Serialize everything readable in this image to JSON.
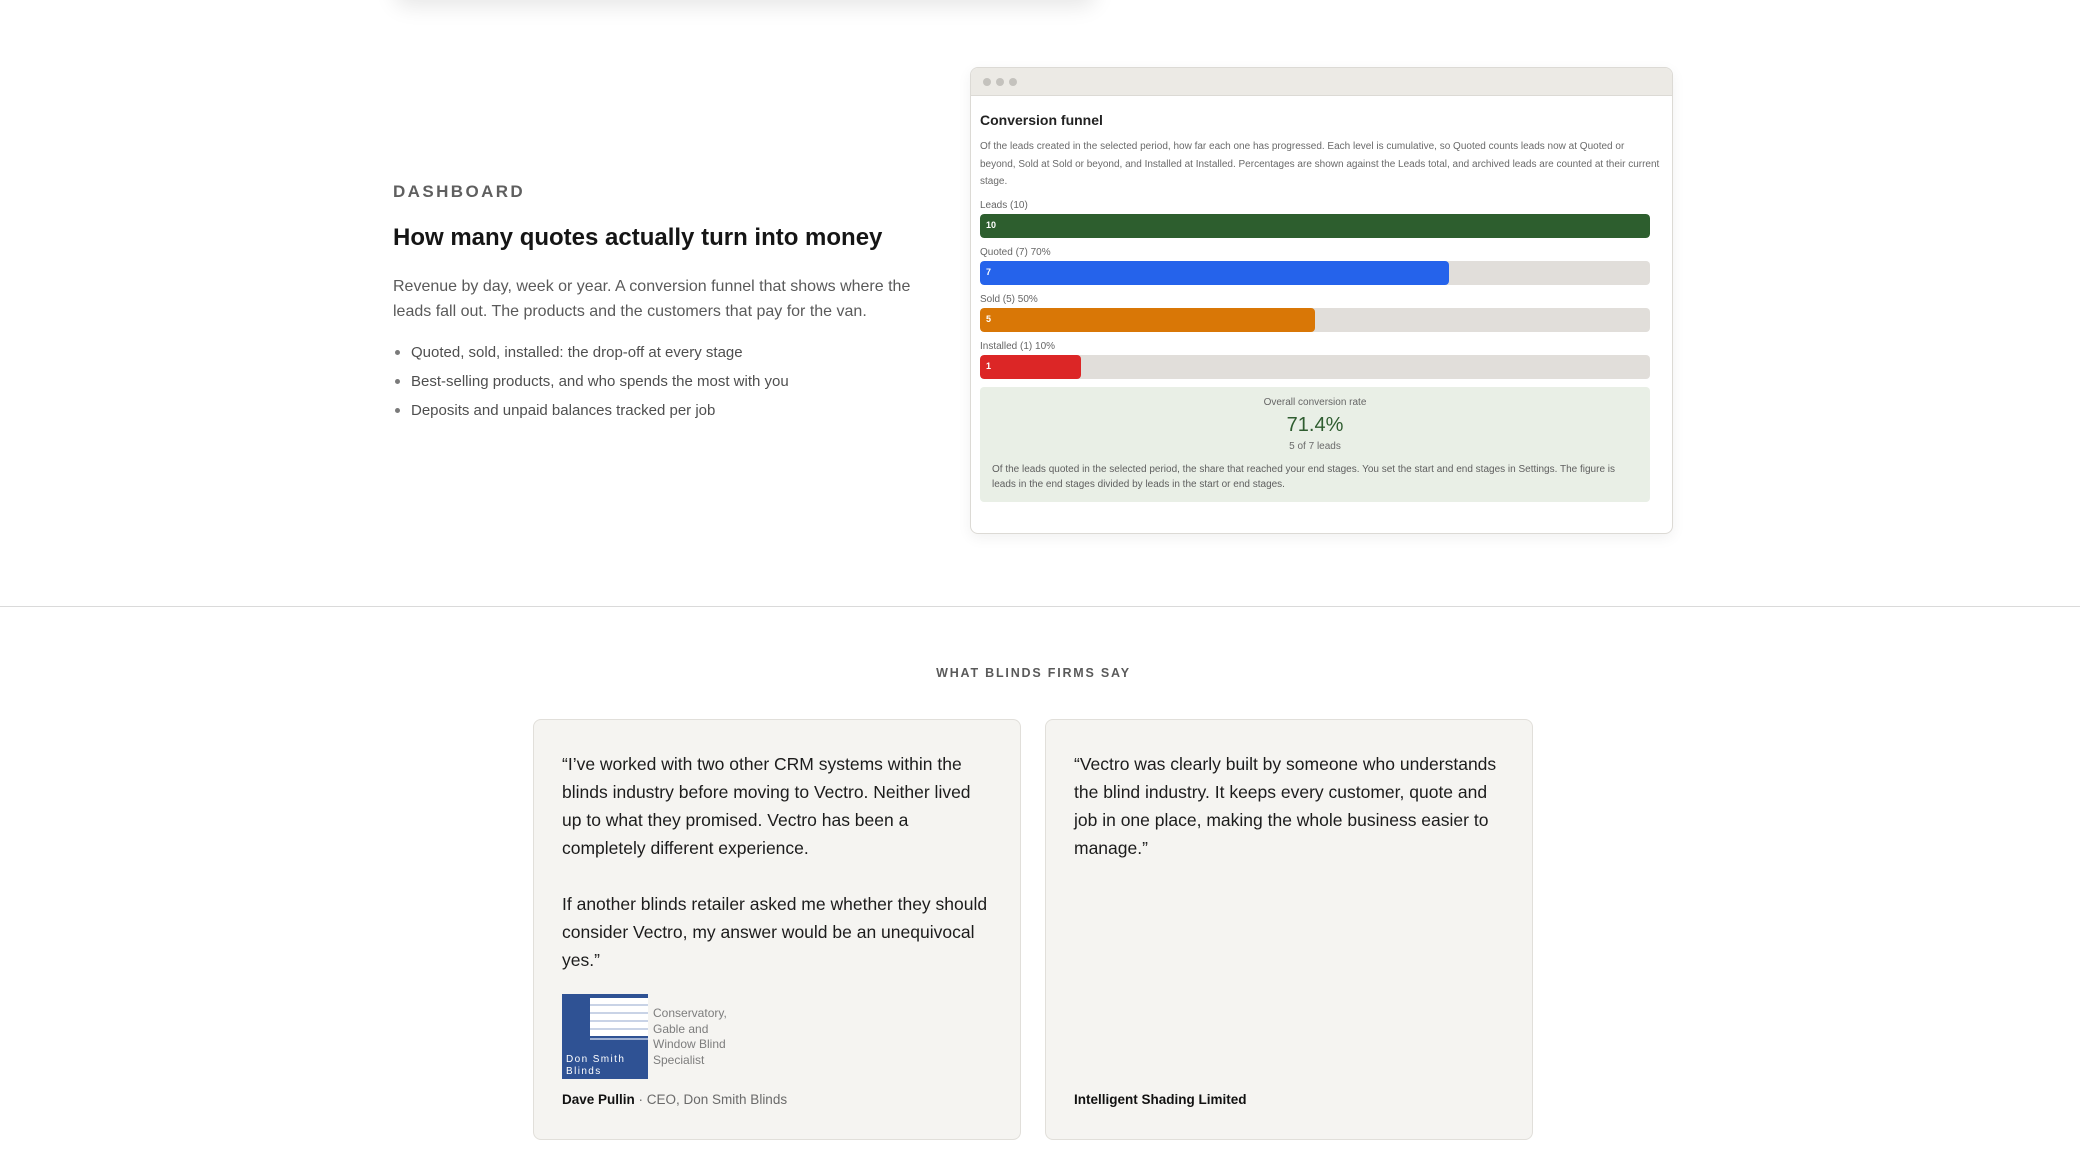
{
  "feature": {
    "eyebrow": "DASHBOARD",
    "heading": "How many quotes actually turn into money",
    "description": "Revenue by day, week or year. A conversion funnel that shows where the leads fall out. The products and the customers that pay for the van.",
    "bullets": [
      "Quoted, sold, installed: the drop-off at every stage",
      "Best-selling products, and who spends the most with you",
      "Deposits and unpaid balances tracked per job"
    ]
  },
  "funnel_window": {
    "title": "Conversion funnel",
    "description": "Of the leads created in the selected period, how far each one has progressed. Each level is cumulative, so Quoted counts leads now at Quoted or beyond, Sold at Sold or beyond, and Installed at Installed. Percentages are shown against the Leads total, and archived leads are counted at their current stage.",
    "stages": [
      {
        "label": "Leads (10)",
        "count": "10",
        "fraction": 1.0,
        "color": "#2d5e2e"
      },
      {
        "label": "Quoted (7) 70%",
        "count": "7",
        "fraction": 0.7,
        "color": "#2563eb"
      },
      {
        "label": "Sold (5) 50%",
        "count": "5",
        "fraction": 0.5,
        "color": "#d97706"
      },
      {
        "label": "Installed (1) 10%",
        "count": "1",
        "fraction": 0.15,
        "color": "#dc2626"
      }
    ],
    "conversion": {
      "label": "Overall conversion rate",
      "value": "71.4%",
      "sub": "5 of 7 leads",
      "description": "Of the leads quoted in the selected period, the share that reached your end stages. You set the start and end stages in Settings. The figure is leads in the end stages divided by leads in the start or end stages."
    }
  },
  "testimonials": {
    "section_title": "WHAT BLINDS FIRMS SAY",
    "cards": [
      {
        "quotes": [
          "“I’ve worked with two other CRM systems within the blinds industry before moving to Vectro. Neither lived up to what they promised. Vectro has been a completely different experience.",
          "If another blinds retailer asked me whether they should consider Vectro, my answer would be an unequivocal yes.”"
        ],
        "logo_text": "Don Smith Blinds",
        "logo_caption": "Conservatory, Gable and Window Blind Specialist",
        "author_name": "Dave Pullin",
        "author_role": " · CEO, Don Smith Blinds"
      },
      {
        "quotes": [
          "“Vectro was clearly built by someone who understands the blind industry. It keeps every customer, quote and job in one place, making the whole business easier to manage.”"
        ],
        "author_name": "Intelligent Shading Limited"
      }
    ]
  }
}
